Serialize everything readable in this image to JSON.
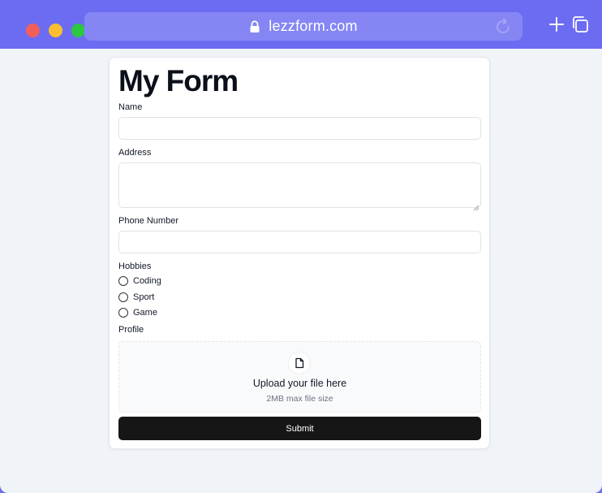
{
  "browser": {
    "url": "lezzform.com",
    "icons": {
      "lock": "lock-icon",
      "reload": "reload-icon",
      "new_tab": "plus-icon",
      "tabs": "tabs-icon"
    },
    "colors": {
      "titlebar": "#6c6cf2",
      "urlbar": "#8586f4"
    }
  },
  "form": {
    "title": "My Form",
    "fields": {
      "name": {
        "label": "Name",
        "value": ""
      },
      "address": {
        "label": "Address",
        "value": ""
      },
      "phone": {
        "label": "Phone Number",
        "value": ""
      }
    },
    "hobbies": {
      "label": "Hobbies",
      "options": [
        "Coding",
        "Sport",
        "Game"
      ]
    },
    "profile": {
      "label": "Profile",
      "upload_title": "Upload your file here",
      "upload_subtitle": "2MB max file size",
      "icon": "file-icon"
    },
    "submit_label": "Submit"
  }
}
